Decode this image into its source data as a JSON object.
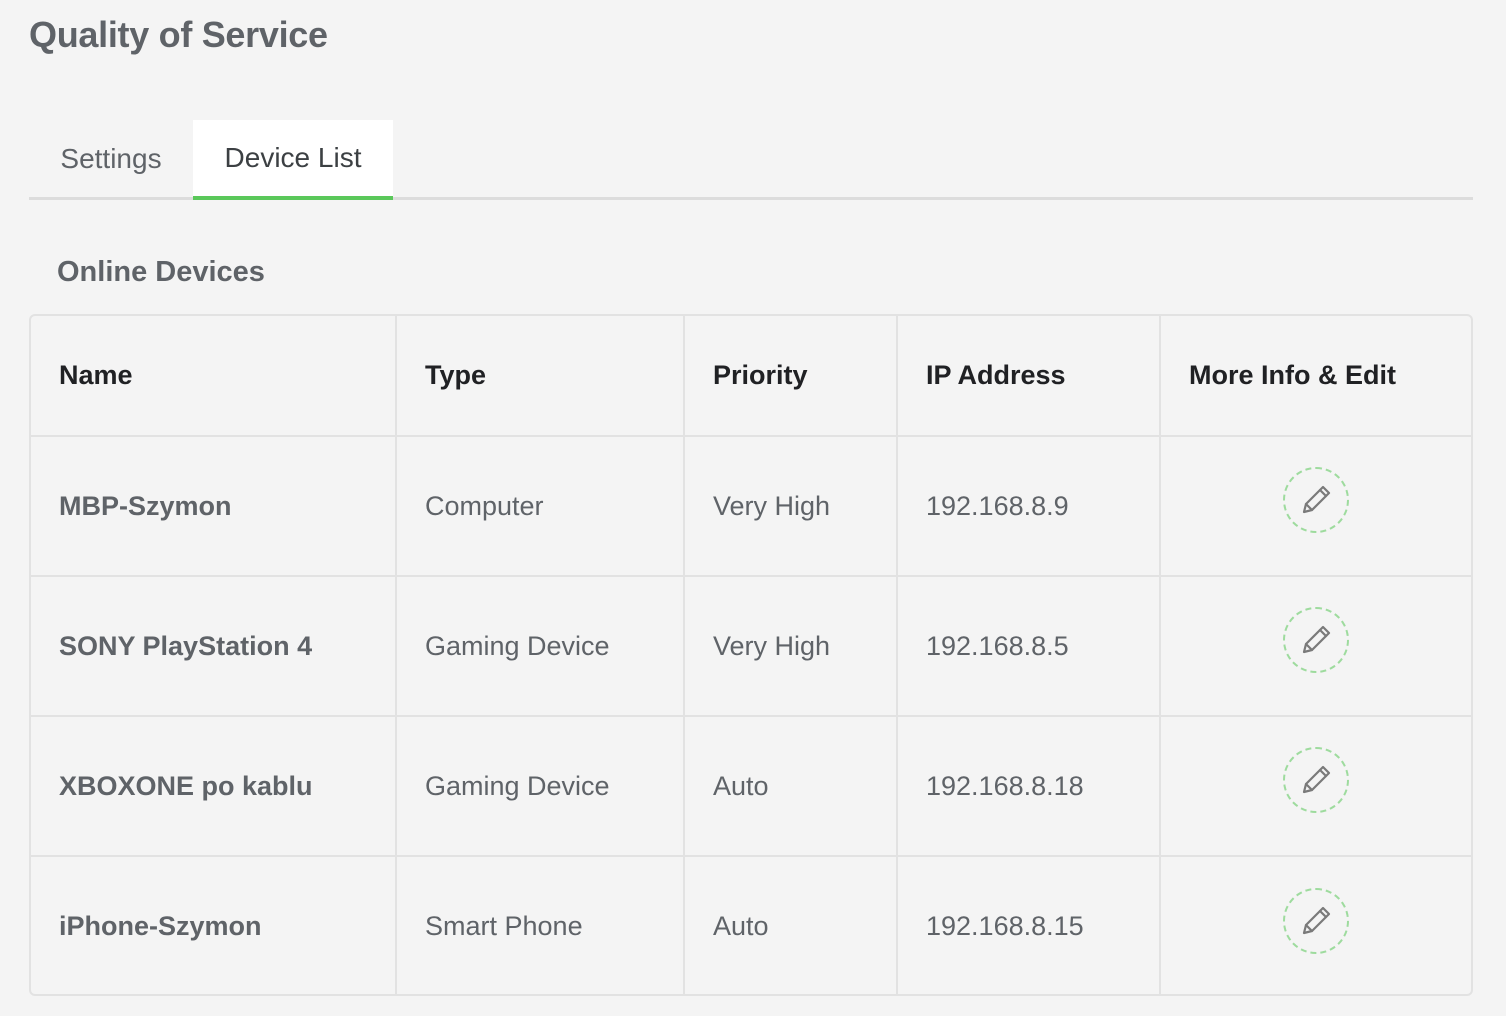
{
  "page": {
    "title": "Quality of Service"
  },
  "tabs": [
    {
      "label": "Settings",
      "active": false
    },
    {
      "label": "Device List",
      "active": true
    }
  ],
  "colors": {
    "accent": "#5ac85a",
    "edit_ring": "#9edb9e",
    "text": "#5f6368",
    "header_text": "#202124",
    "border": "#e2e2e2",
    "background": "#f4f4f4"
  },
  "online_devices": {
    "title": "Online Devices",
    "columns": {
      "name": "Name",
      "type": "Type",
      "priority": "Priority",
      "ip": "IP Address",
      "edit": "More Info & Edit"
    },
    "rows": [
      {
        "name": "MBP-Szymon",
        "type": "Computer",
        "priority": "Very High",
        "ip": "192.168.8.9",
        "edit_icon": "pencil-icon"
      },
      {
        "name": "SONY PlayStation 4",
        "type": "Gaming Device",
        "priority": "Very High",
        "ip": "192.168.8.5",
        "edit_icon": "pencil-icon"
      },
      {
        "name": "XBOXONE po kablu",
        "type": "Gaming Device",
        "priority": "Auto",
        "ip": "192.168.8.18",
        "edit_icon": "pencil-icon"
      },
      {
        "name": "iPhone-Szymon",
        "type": "Smart Phone",
        "priority": "Auto",
        "ip": "192.168.8.15",
        "edit_icon": "pencil-icon"
      }
    ]
  }
}
